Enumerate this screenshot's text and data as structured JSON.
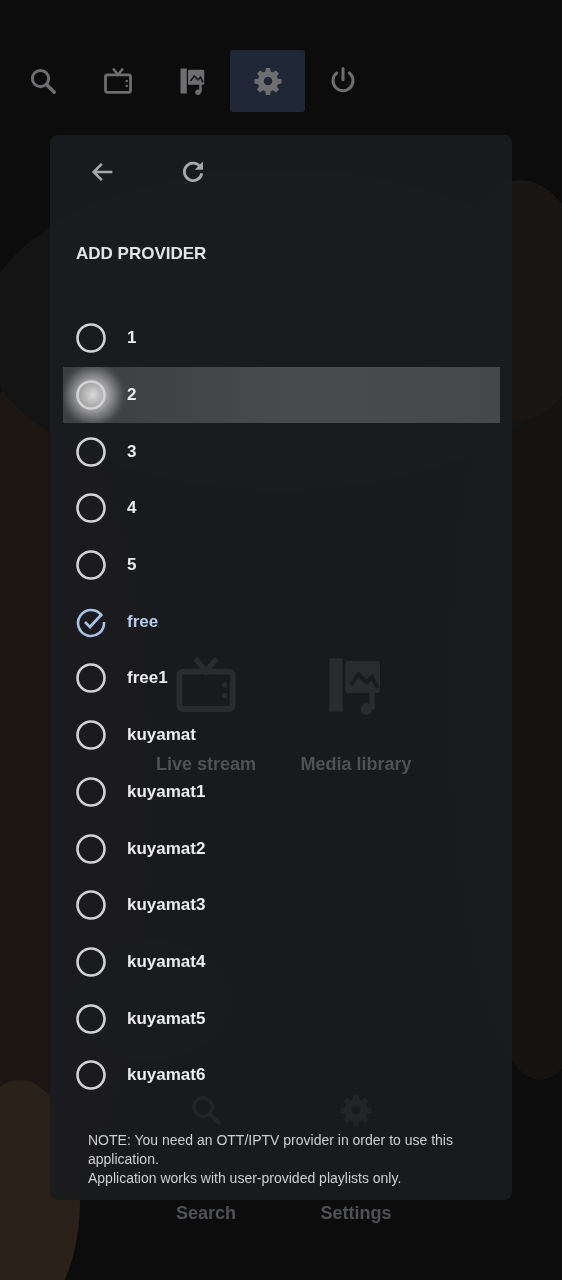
{
  "nav": [
    {
      "kind": "search",
      "selected": false
    },
    {
      "kind": "tv",
      "selected": false
    },
    {
      "kind": "media",
      "selected": false
    },
    {
      "kind": "settings",
      "selected": true
    },
    {
      "kind": "power",
      "selected": false
    }
  ],
  "home_tiles": [
    {
      "kind": "tv",
      "label": "Live stream"
    },
    {
      "kind": "media",
      "label": "Media library"
    },
    {
      "kind": "search",
      "label": "Search"
    },
    {
      "kind": "settings",
      "label": "Settings"
    }
  ],
  "dialog": {
    "title": "ADD PROVIDER",
    "providers": [
      {
        "name": "1",
        "selected": false,
        "focused": false
      },
      {
        "name": "2",
        "selected": false,
        "focused": true
      },
      {
        "name": "3",
        "selected": false,
        "focused": false
      },
      {
        "name": "4",
        "selected": false,
        "focused": false
      },
      {
        "name": "5",
        "selected": false,
        "focused": false
      },
      {
        "name": "free",
        "selected": true,
        "focused": false
      },
      {
        "name": "free1",
        "selected": false,
        "focused": false
      },
      {
        "name": "kuyamat",
        "selected": false,
        "focused": false
      },
      {
        "name": "kuyamat1",
        "selected": false,
        "focused": false
      },
      {
        "name": "kuyamat2",
        "selected": false,
        "focused": false
      },
      {
        "name": "kuyamat3",
        "selected": false,
        "focused": false
      },
      {
        "name": "kuyamat4",
        "selected": false,
        "focused": false
      },
      {
        "name": "kuyamat5",
        "selected": false,
        "focused": false
      },
      {
        "name": "kuyamat6",
        "selected": false,
        "focused": false
      }
    ],
    "note": [
      "NOTE: You need an OTT/IPTV provider in order to use this application.",
      "Application works with user-provided playlists only."
    ]
  }
}
